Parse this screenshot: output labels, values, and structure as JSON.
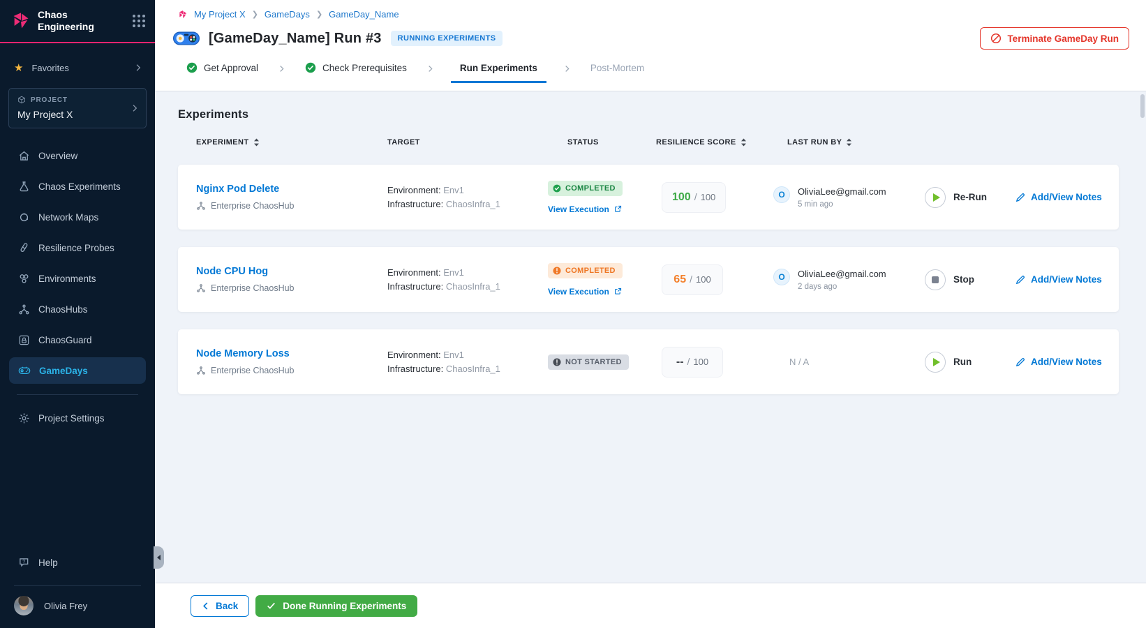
{
  "colors": {
    "brand_pink": "#ee2c76",
    "primary_blue": "#0278d5",
    "nav_active_blue": "#2bb3e8",
    "success_green": "#1b9e4c",
    "warning_orange": "#f07a28",
    "danger_red": "#e4352a",
    "done_button_green": "#42ab45",
    "sidebar_bg": "#0a1a2c",
    "content_bg": "#eff3f9"
  },
  "sidebar": {
    "brand_line1": "Chaos",
    "brand_line2": "Engineering",
    "favorites_label": "Favorites",
    "project_label": "PROJECT",
    "project_name": "My Project X",
    "nav": [
      {
        "label": "Overview"
      },
      {
        "label": "Chaos Experiments"
      },
      {
        "label": "Network Maps"
      },
      {
        "label": "Resilience Probes"
      },
      {
        "label": "Environments"
      },
      {
        "label": "ChaosHubs"
      },
      {
        "label": "ChaosGuard"
      },
      {
        "label": "GameDays"
      }
    ],
    "project_settings_label": "Project Settings",
    "help_label": "Help",
    "user_name": "Olivia Frey"
  },
  "header": {
    "breadcrumb": {
      "items": [
        "My Project X",
        "GameDays",
        "GameDay_Name"
      ]
    },
    "title": "[GameDay_Name] Run #3",
    "status_badge": "RUNNING EXPERIMENTS",
    "terminate_button": "Terminate GameDay Run"
  },
  "stepper": {
    "steps": [
      {
        "label": "Get Approval",
        "state": "done"
      },
      {
        "label": "Check Prerequisites",
        "state": "done"
      },
      {
        "label": "Run Experiments",
        "state": "active"
      },
      {
        "label": "Post-Mortem",
        "state": "upcoming"
      }
    ]
  },
  "experiments": {
    "heading": "Experiments",
    "columns": {
      "experiment": "EXPERIMENT",
      "target": "TARGET",
      "status": "STATUS",
      "resilience_score": "RESILIENCE SCORE",
      "last_run_by": "LAST RUN BY"
    },
    "labels": {
      "environment": "Environment:",
      "infrastructure": "Infrastructure:",
      "view_execution": "View Execution",
      "not_available": "N / A"
    },
    "rows": [
      {
        "name": "Nginx Pod Delete",
        "hub": "Enterprise ChaosHub",
        "environment": "Env1",
        "infrastructure": "ChaosInfra_1",
        "status": "COMPLETED",
        "status_kind": "success",
        "score": "100",
        "score_sep": "/",
        "score_max": "100",
        "avatar_initial": "O",
        "last_run_by": "OliviaLee@gmail.com",
        "last_run_time": "5 min ago",
        "action": "Re-Run",
        "notes": "Add/View Notes"
      },
      {
        "name": "Node CPU Hog",
        "hub": "Enterprise ChaosHub",
        "environment": "Env1",
        "infrastructure": "ChaosInfra_1",
        "status": "COMPLETED",
        "status_kind": "warning",
        "score": "65",
        "score_sep": "/",
        "score_max": "100",
        "avatar_initial": "O",
        "last_run_by": "OliviaLee@gmail.com",
        "last_run_time": "2 days ago",
        "action": "Stop",
        "notes": "Add/View Notes"
      },
      {
        "name": "Node Memory Loss",
        "hub": "Enterprise ChaosHub",
        "environment": "Env1",
        "infrastructure": "ChaosInfra_1",
        "status": "NOT STARTED",
        "status_kind": "neutral",
        "score": "--",
        "score_sep": "/",
        "score_max": "100",
        "action": "Run",
        "notes": "Add/View Notes"
      }
    ]
  },
  "footer": {
    "back_button": "Back",
    "done_button": "Done Running Experiments"
  }
}
